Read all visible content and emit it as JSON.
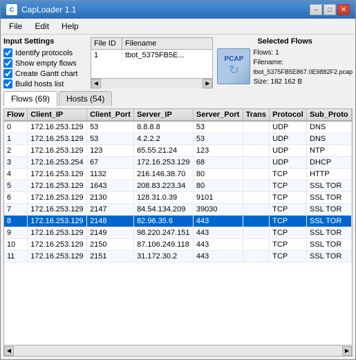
{
  "window": {
    "title": "CapLoader 1.1"
  },
  "menu": {
    "items": [
      "File",
      "Edit",
      "Help"
    ]
  },
  "input_settings": {
    "label": "Input Settings",
    "checkboxes": [
      {
        "id": "identify-protocols",
        "label": "Identify protocols",
        "checked": true
      },
      {
        "id": "show-empty-flows",
        "label": "Show empty flows",
        "checked": true
      },
      {
        "id": "create-gantt",
        "label": "Create Gantt chart",
        "checked": true
      },
      {
        "id": "build-hosts",
        "label": "Build hosts list",
        "checked": true
      }
    ]
  },
  "file_list": {
    "columns": [
      "File ID",
      "Filename"
    ],
    "rows": [
      {
        "id": "1",
        "filename": "tbot_5375FB5E..."
      }
    ]
  },
  "selected_flows": {
    "title": "Selected Flows",
    "flows_label": "Flows:",
    "flows_value": "1",
    "filename_label": "Filename:",
    "filename_value": "tbot_5375FB5E867.0E9882F2.pcap",
    "size_label": "Size:",
    "size_value": "182 162 B"
  },
  "tabs": [
    {
      "id": "flows",
      "label": "Flows (69)",
      "active": true
    },
    {
      "id": "hosts",
      "label": "Hosts (54)",
      "active": false
    }
  ],
  "table": {
    "columns": [
      "Flow",
      "Client_IP",
      "Client_Port",
      "Server_IP",
      "Server_Port",
      "Trans",
      "Protocol",
      "Sub_Proto"
    ],
    "rows": [
      {
        "flow": "0",
        "client_ip": "172.16.253.129",
        "client_port": "53",
        "server_ip": "8.8.8.8",
        "server_port": "53",
        "trans": "",
        "protocol": "UDP",
        "sub_proto": "DNS",
        "selected": false
      },
      {
        "flow": "1",
        "client_ip": "172.16.253.129",
        "client_port": "53",
        "server_ip": "4.2.2.2",
        "server_port": "53",
        "trans": "",
        "protocol": "UDP",
        "sub_proto": "DNS",
        "selected": false
      },
      {
        "flow": "2",
        "client_ip": "172.16.253.129",
        "client_port": "123",
        "server_ip": "65.55.21.24",
        "server_port": "123",
        "trans": "",
        "protocol": "UDP",
        "sub_proto": "NTP",
        "selected": false
      },
      {
        "flow": "3",
        "client_ip": "172.16.253.254",
        "client_port": "67",
        "server_ip": "172.16.253.129",
        "server_port": "68",
        "trans": "",
        "protocol": "UDP",
        "sub_proto": "DHCP",
        "selected": false
      },
      {
        "flow": "4",
        "client_ip": "172.16.253.129",
        "client_port": "1132",
        "server_ip": "216.146.38.70",
        "server_port": "80",
        "trans": "",
        "protocol": "TCP",
        "sub_proto": "HTTP",
        "selected": false
      },
      {
        "flow": "5",
        "client_ip": "172.16.253.129",
        "client_port": "1643",
        "server_ip": "208.83.223.34",
        "server_port": "80",
        "trans": "",
        "protocol": "TCP",
        "sub_proto": "SSL",
        "sub_proto2": "TOR",
        "selected": false
      },
      {
        "flow": "6",
        "client_ip": "172.16.253.129",
        "client_port": "2130",
        "server_ip": "128.31.0.39",
        "server_port": "9101",
        "trans": "",
        "protocol": "TCP",
        "sub_proto": "SSL",
        "sub_proto2": "TOR",
        "selected": false
      },
      {
        "flow": "7",
        "client_ip": "172.16.253.129",
        "client_port": "2147",
        "server_ip": "84.54.134.209",
        "server_port": "39030",
        "trans": "",
        "protocol": "TCP",
        "sub_proto": "SSL",
        "sub_proto2": "TOR",
        "selected": false
      },
      {
        "flow": "8",
        "client_ip": "172.16.253.129",
        "client_port": "2148",
        "server_ip": "82.96.35.6",
        "server_port": "443",
        "trans": "",
        "protocol": "TCP",
        "sub_proto": "SSL",
        "sub_proto2": "TOR",
        "selected": true
      },
      {
        "flow": "9",
        "client_ip": "172.16.253.129",
        "client_port": "2149",
        "server_ip": "98.220.247.151",
        "server_port": "443",
        "trans": "",
        "protocol": "TCP",
        "sub_proto": "SSL",
        "sub_proto2": "TOR",
        "selected": false
      },
      {
        "flow": "10",
        "client_ip": "172.16.253.129",
        "client_port": "2150",
        "server_ip": "87.106.249.118",
        "server_port": "443",
        "trans": "",
        "protocol": "TCP",
        "sub_proto": "SSL",
        "sub_proto2": "TOR",
        "selected": false
      },
      {
        "flow": "11",
        "client_ip": "172.16.253.129",
        "client_port": "2151",
        "server_ip": "31.172.30.2",
        "server_port": "443",
        "trans": "",
        "protocol": "TCP",
        "sub_proto": "SSL",
        "sub_proto2": "TOR",
        "selected": false
      }
    ]
  }
}
